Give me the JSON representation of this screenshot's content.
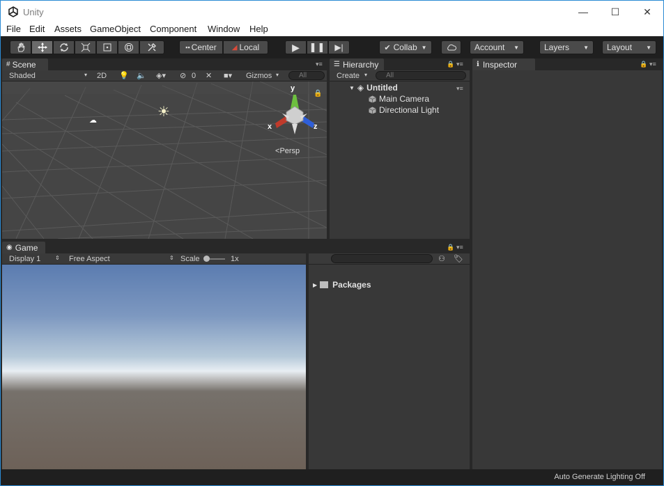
{
  "window": {
    "title": "Unity",
    "buttons": {
      "minimize": "—",
      "maximize": "☐",
      "close": "✕"
    }
  },
  "menu": [
    "File",
    "Edit",
    "Assets",
    "GameObject",
    "Component",
    "Window",
    "Help"
  ],
  "toolbar": {
    "tools": [
      "hand-tool",
      "move-tool",
      "rotate-tool",
      "scale-tool",
      "rect-tool",
      "transform-tool",
      "custom-tool"
    ],
    "active_tool": "move-tool",
    "pivot_label": "Center",
    "space_label": "Local",
    "collab_label": "Collab",
    "account_label": "Account",
    "layers_label": "Layers",
    "layout_label": "Layout"
  },
  "scene": {
    "tab_label": "Scene",
    "shading": "Shaded",
    "mode_2d": "2D",
    "hidden_count": "0",
    "gizmos_label": "Gizmos",
    "search_placeholder": "All",
    "persp_label": "Persp",
    "axis": {
      "x": "x",
      "y": "y",
      "z": "z"
    }
  },
  "game": {
    "tab_label": "Game",
    "display": "Display 1",
    "aspect": "Free Aspect",
    "scale_label": "Scale",
    "scale_value": "1x"
  },
  "hierarchy": {
    "tab_label": "Hierarchy",
    "create_label": "Create",
    "search_placeholder": "All",
    "scene_name": "Untitled",
    "items": [
      "Main Camera",
      "Directional Light"
    ]
  },
  "project": {
    "packages_label": "Packages"
  },
  "inspector": {
    "tab_label": "Inspector"
  },
  "status": {
    "text": "Auto Generate Lighting Off"
  },
  "colors": {
    "accent": "#2a8ad4",
    "panel": "#383838",
    "toolbar": "#1f1f1f"
  }
}
